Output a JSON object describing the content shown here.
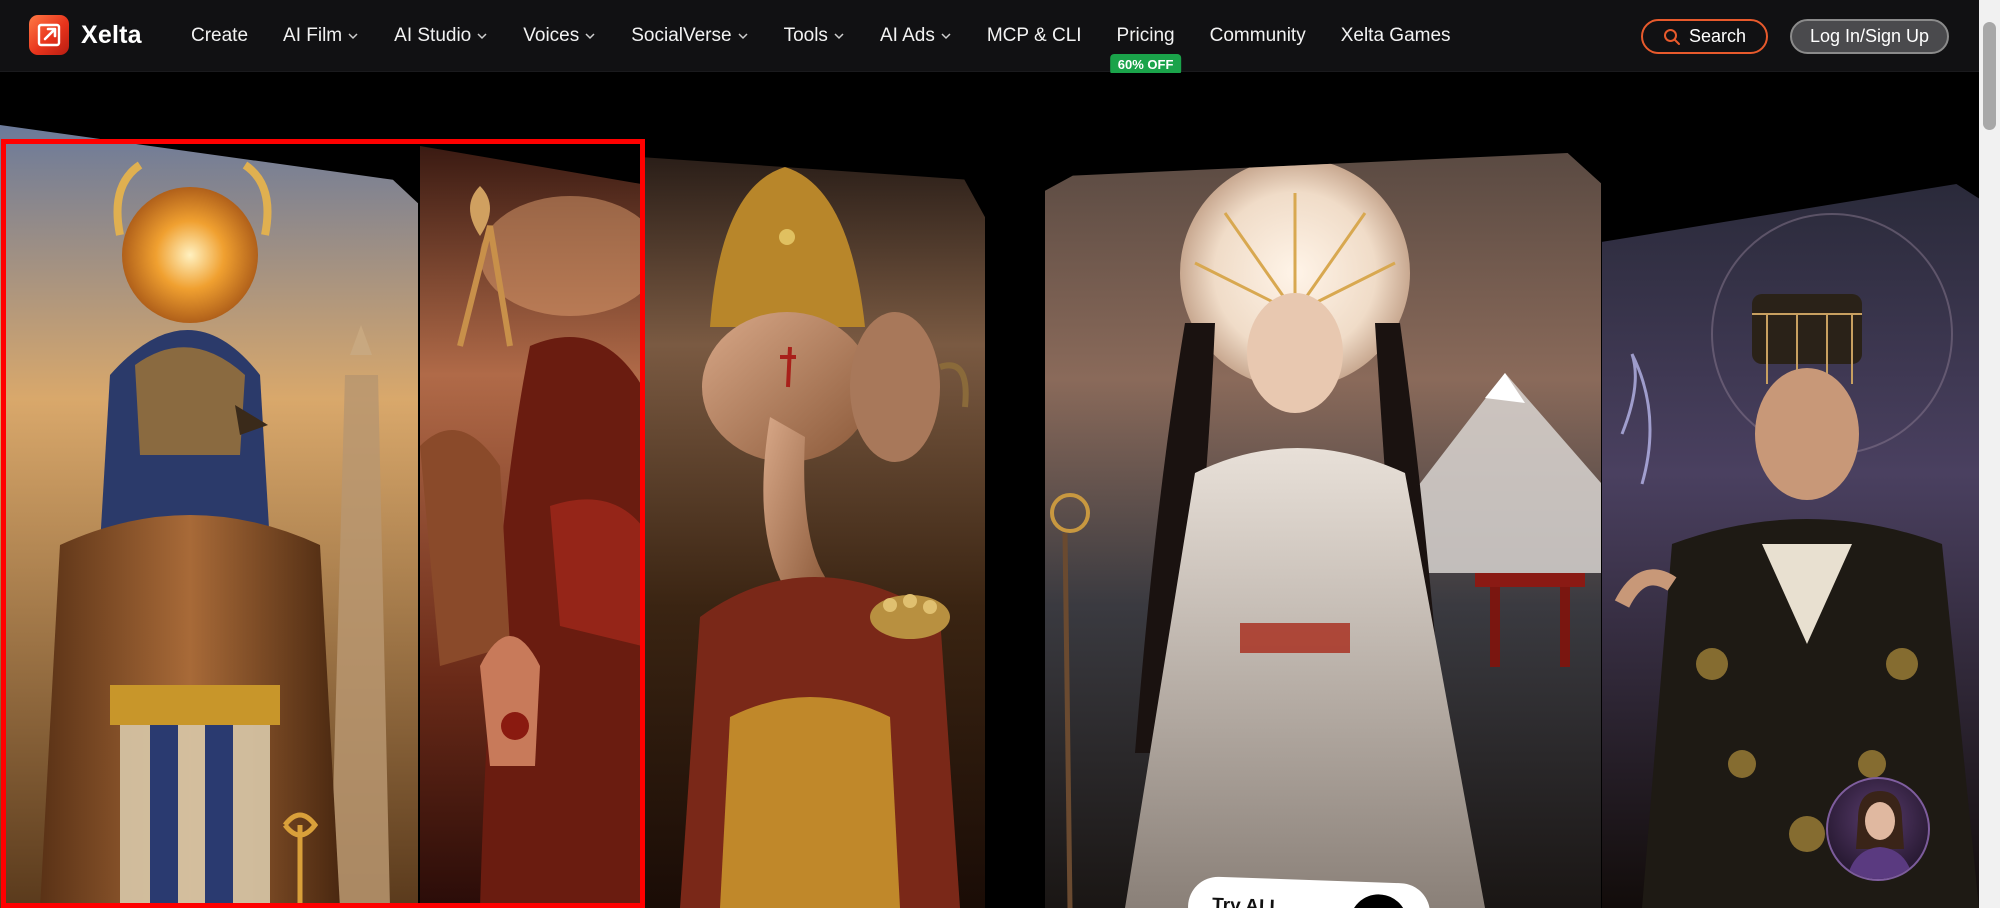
{
  "brand": {
    "name": "Xelta"
  },
  "nav": {
    "items": [
      {
        "label": "Create",
        "dropdown": false
      },
      {
        "label": "AI Film",
        "dropdown": true
      },
      {
        "label": "AI Studio",
        "dropdown": true
      },
      {
        "label": "Voices",
        "dropdown": true
      },
      {
        "label": "SocialVerse",
        "dropdown": true
      },
      {
        "label": "Tools",
        "dropdown": true
      },
      {
        "label": "AI Ads",
        "dropdown": true
      },
      {
        "label": "MCP & CLI",
        "dropdown": false
      },
      {
        "label": "Pricing",
        "dropdown": false,
        "badge": "60% OFF"
      },
      {
        "label": "Community",
        "dropdown": false
      },
      {
        "label": "Xelta Games",
        "dropdown": false
      }
    ],
    "search_label": "Search",
    "login_label": "Log In/Sign Up"
  },
  "hero": {
    "cards": [
      {
        "name": "horus-card",
        "subject": "Egyptian falcon god"
      },
      {
        "name": "warrior-card",
        "subject": "Crimson warrior deity"
      },
      {
        "name": "ganesh-card",
        "subject": "Elephant deity"
      },
      {
        "name": "empress-card",
        "subject": "Japanese goddess"
      },
      {
        "name": "emperor-card",
        "subject": "Chinese emperor"
      }
    ],
    "try_pill_text": "Try AI I"
  },
  "colors": {
    "accent": "#e85a2c",
    "badge": "#1aa34a",
    "highlight": "#ff0000",
    "nav_bg": "#111113"
  }
}
